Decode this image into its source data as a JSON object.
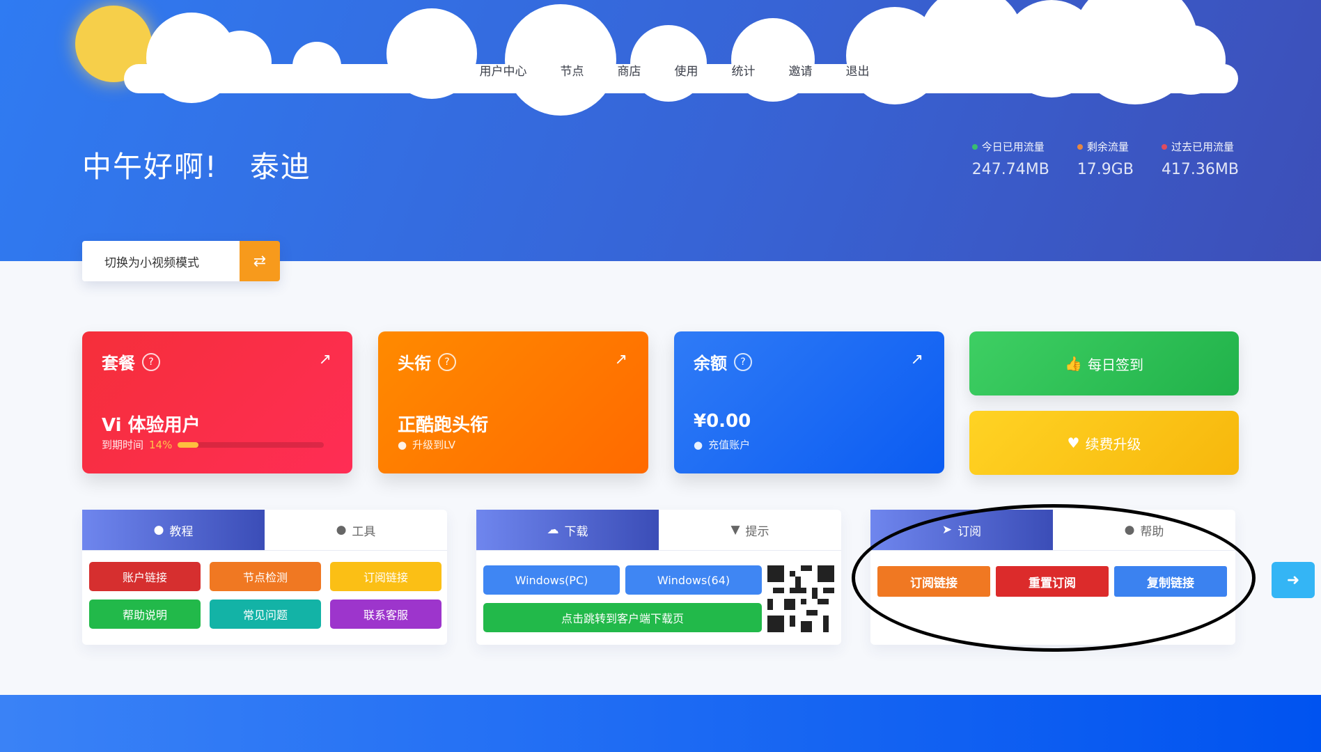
{
  "nav": {
    "items": [
      "用户中心",
      "节点",
      "商店",
      "使用",
      "统计",
      "邀请",
      "退出"
    ]
  },
  "greeting": {
    "hello": "中午好啊!",
    "name": "泰迪"
  },
  "traffic": {
    "items": [
      {
        "label": "今日已用流量",
        "value": "247.74MB",
        "dot_color": "#39c46c"
      },
      {
        "label": "剩余流量",
        "value": "17.9GB",
        "dot_color": "#f08a3a"
      },
      {
        "label": "过去已用流量",
        "value": "417.36MB",
        "dot_color": "#e74c5a"
      }
    ]
  },
  "version_switch": {
    "label": "切换为小视频模式",
    "icon": "swap-icon"
  },
  "cards": [
    {
      "title": "套餐",
      "main": "Vi 体验用户",
      "sub_label": "到期时间",
      "progress_label": "14%",
      "progress": 0.14
    },
    {
      "title": "头衔",
      "main": "正酷跑头衔",
      "sub_label": "升级到LV"
    },
    {
      "title": "余额",
      "main": "¥0.00",
      "sub_label": "充值账户"
    }
  ],
  "actions": {
    "checkin": "每日签到",
    "renew": "续费升级"
  },
  "panel_left": {
    "tabs": [
      "教程",
      "工具"
    ],
    "buttons": [
      {
        "label": "账户链接",
        "color": "#d62f2f"
      },
      {
        "label": "节点检测",
        "color": "#f07822"
      },
      {
        "label": "订阅链接",
        "color": "#fbbf15"
      },
      {
        "label": "帮助说明",
        "color": "#22b94a"
      },
      {
        "label": "常见问题",
        "color": "#13b3a6"
      },
      {
        "label": "联系客服",
        "color": "#9d35cc"
      }
    ]
  },
  "panel_mid": {
    "tabs": [
      "下载",
      "提示"
    ],
    "buttons_row": [
      "Windows(PC)",
      "Windows(64)"
    ],
    "wide_button": "点击跳转到客户端下载页"
  },
  "panel_right": {
    "tabs": [
      "订阅",
      "帮助"
    ],
    "buttons": [
      "订阅链接",
      "重置订阅",
      "复制链接"
    ]
  },
  "float_button_icon": "arrow-right-icon"
}
